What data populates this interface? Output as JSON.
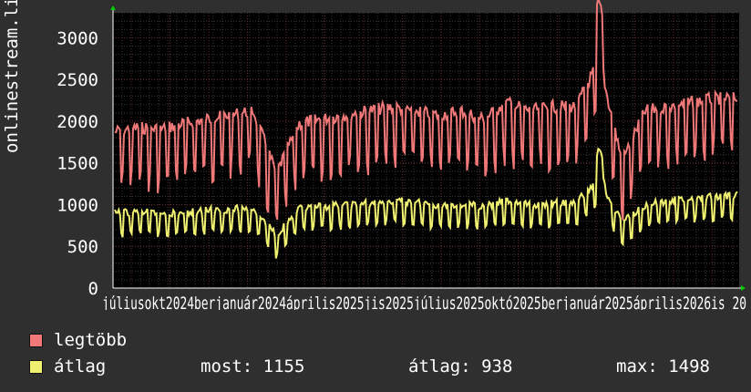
{
  "chart_data": {
    "type": "line",
    "ylabel": "onlinestream.live",
    "ylim": [
      0,
      3300
    ],
    "yticks": [
      0,
      500,
      1000,
      1500,
      2000,
      2500,
      3000
    ],
    "grid": true,
    "x_tick_labels": [
      "július",
      "október",
      "2024",
      "január",
      "április",
      "július",
      "október",
      "2025",
      "január",
      "április",
      "július",
      "október",
      "2026",
      "január",
      "április",
      "július"
    ],
    "x_tick_label_text": "júliusokt2024berjanuár2024április2025jis2025július2025októ2025berjanuár2025április2026is 20",
    "series": [
      {
        "name": "legtöbb",
        "color": "#f07878",
        "baseline": 2000,
        "dip": 1250,
        "levels": [
          1950,
          2000,
          1980,
          2050,
          2100,
          2150,
          2200,
          1450,
          2050,
          2100,
          2150,
          2200,
          2250,
          2200,
          2150,
          2200,
          2100,
          2300,
          2200,
          2250,
          2250,
          2800,
          1600,
          2200,
          2250,
          2300,
          2350,
          2350
        ]
      },
      {
        "name": "átlag",
        "color": "#f0f070",
        "baseline": 920,
        "dip": 680,
        "levels": [
          900,
          920,
          900,
          910,
          940,
          950,
          960,
          650,
          950,
          980,
          1000,
          1020,
          1050,
          1040,
          1000,
          1010,
          980,
          1050,
          1000,
          1020,
          1030,
          1300,
          800,
          1000,
          1050,
          1080,
          1100,
          1120
        ]
      }
    ],
    "legend": [
      {
        "label": "legtöbb",
        "color": "#f07878"
      },
      {
        "label": "átlag",
        "color": "#f0f070"
      }
    ],
    "stats": {
      "most": "most: 1155",
      "atlag": "átlag: 938",
      "max": "max: 1498"
    }
  }
}
